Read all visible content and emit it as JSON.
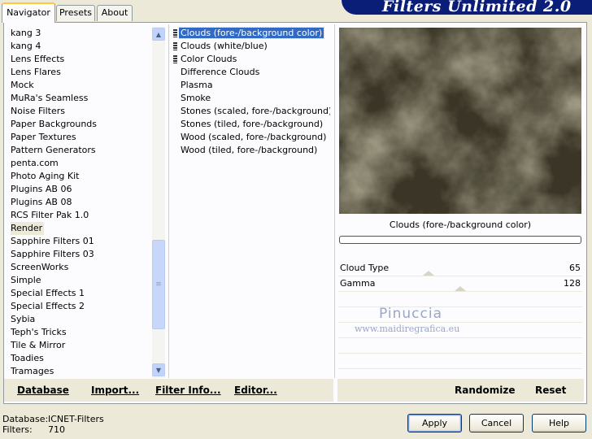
{
  "tabs": [
    "Navigator",
    "Presets",
    "About"
  ],
  "banner_title": "Filters Unlimited 2.0",
  "categories": [
    "kang 3",
    "kang 4",
    "Lens Effects",
    "Lens Flares",
    "Mock",
    "MuRa's Seamless",
    "Noise Filters",
    "Paper Backgrounds",
    "Paper Textures",
    "Pattern Generators",
    "penta.com",
    "Photo Aging Kit",
    "Plugins AB 06",
    "Plugins AB 08",
    "RCS Filter Pak 1.0",
    "Render",
    "Sapphire Filters 01",
    "Sapphire Filters 03",
    "ScreenWorks",
    "Simple",
    "Special Effects 1",
    "Special Effects 2",
    "Sybia",
    "Teph's Tricks",
    "Tile & Mirror",
    "Toadies",
    "Tramages"
  ],
  "selected_category": "Render",
  "filters": [
    "Clouds (fore-/background color)",
    "Clouds (white/blue)",
    "Color Clouds",
    "Difference Clouds",
    "Plasma",
    "Smoke",
    "Stones (scaled, fore-/background)",
    "Stones (tiled, fore-/background)",
    "Wood (scaled, fore-/background)",
    "Wood (tiled, fore-/background)"
  ],
  "selected_filter": "Clouds (fore-/background color)",
  "preview_caption": "Clouds (fore-/background color)",
  "progress": 0,
  "params": [
    {
      "name": "Cloud Type",
      "value": "65",
      "level": 0.255
    },
    {
      "name": "Gamma",
      "value": "128",
      "level": 0.502
    }
  ],
  "watermark": {
    "name": "Pinuccia",
    "url": "www.maidiregrafica.eu"
  },
  "buttons": {
    "database": "Database",
    "import": "Import...",
    "filter_info": "Filter Info...",
    "editor": "Editor...",
    "randomize": "Randomize",
    "reset": "Reset",
    "apply": "Apply",
    "cancel": "Cancel",
    "help": "Help"
  },
  "status": {
    "database_label": "Database:",
    "database_value": "ICNET-Filters",
    "filters_label": "Filters:",
    "filters_value": "710"
  },
  "colors": {
    "selection": "#316ac5",
    "banner": "#0a1e78",
    "preview_dark": "#3a3526",
    "preview_light": "#8a8460"
  }
}
